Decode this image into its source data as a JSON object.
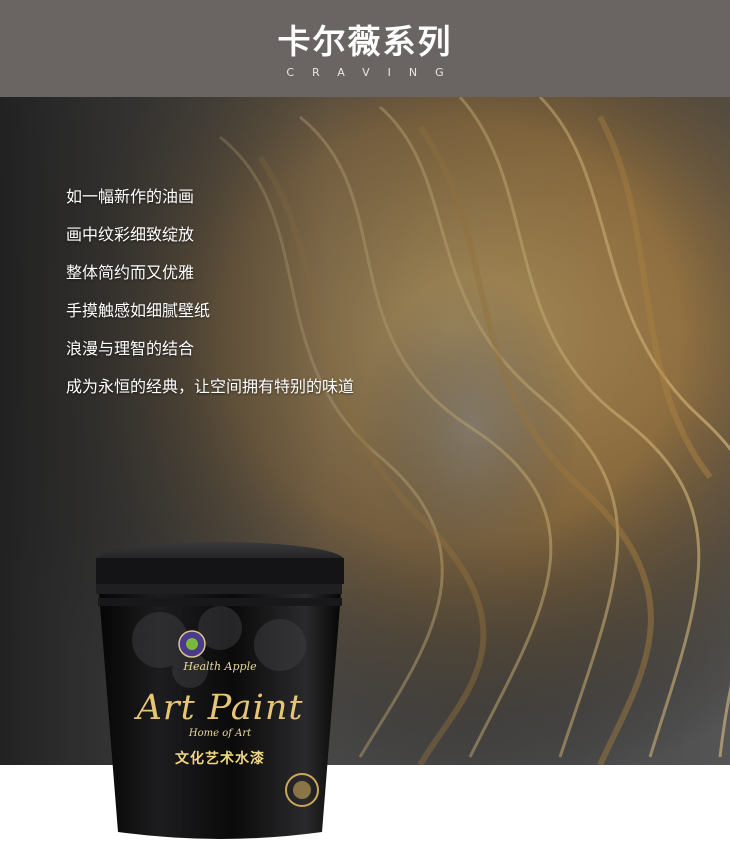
{
  "header": {
    "title": "卡尔薇系列",
    "subtitle": "CRAVING"
  },
  "poem": {
    "lines": [
      "如一幅新作的油画",
      "画中纹彩细致绽放",
      "整体简约而又优雅",
      "手摸触感如细腻壁纸",
      "浪漫与理智的结合",
      "成为永恒的经典，让空间拥有特别的味道"
    ]
  },
  "product": {
    "script_label": "Health Apple",
    "brand": "Art Paint",
    "tagline": "Home of Art",
    "name_cn": "文化艺术水漆"
  },
  "colors": {
    "header_bg": "#6a6563",
    "title": "#ffffff",
    "accent_gold": "#e6c676"
  }
}
